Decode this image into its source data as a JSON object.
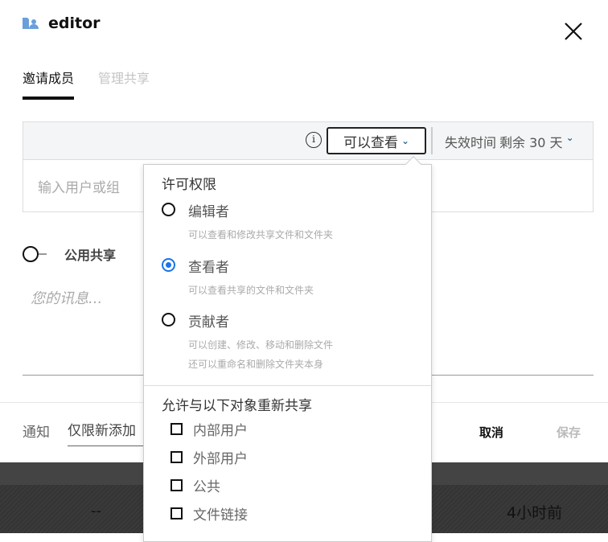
{
  "background": {
    "cell_a": "--",
    "cell_b": "4小时前"
  },
  "header": {
    "title": "editor",
    "close": "×"
  },
  "tabs": [
    {
      "label": "邀请成员"
    },
    {
      "label": "管理共享"
    }
  ],
  "share_bar": {
    "info": "i",
    "permission": "可以查看",
    "expire_label": "失效时间",
    "expire_value": "剩余 30 天"
  },
  "invite": {
    "placeholder": "输入用户或组"
  },
  "public_share": {
    "label": "公用共享"
  },
  "message": {
    "placeholder": "您的讯息..."
  },
  "footer": {
    "notify_label": "通知",
    "notify_value": "仅限新添加",
    "cancel": "取消",
    "save": "保存"
  },
  "dropdown": {
    "permissions_heading": "许可权限",
    "roles": [
      {
        "label": "编辑者",
        "desc": [
          "可以查看和修改共享文件和文件夹"
        ],
        "selected": false
      },
      {
        "label": "查看者",
        "desc": [
          "可以查看共享的文件和文件夹"
        ],
        "selected": true
      },
      {
        "label": "贡献者",
        "desc": [
          "可以创建、修改、移动和删除文件",
          "还可以重命名和删除文件夹本身"
        ],
        "selected": false
      }
    ],
    "reshare_heading": "允许与以下对象重新共享",
    "reshare": [
      {
        "label": "内部用户"
      },
      {
        "label": "外部用户"
      },
      {
        "label": "公共"
      },
      {
        "label": "文件链接"
      }
    ]
  },
  "colors": {
    "accent": "#1a73e8",
    "icon": "#6a9fdc"
  }
}
